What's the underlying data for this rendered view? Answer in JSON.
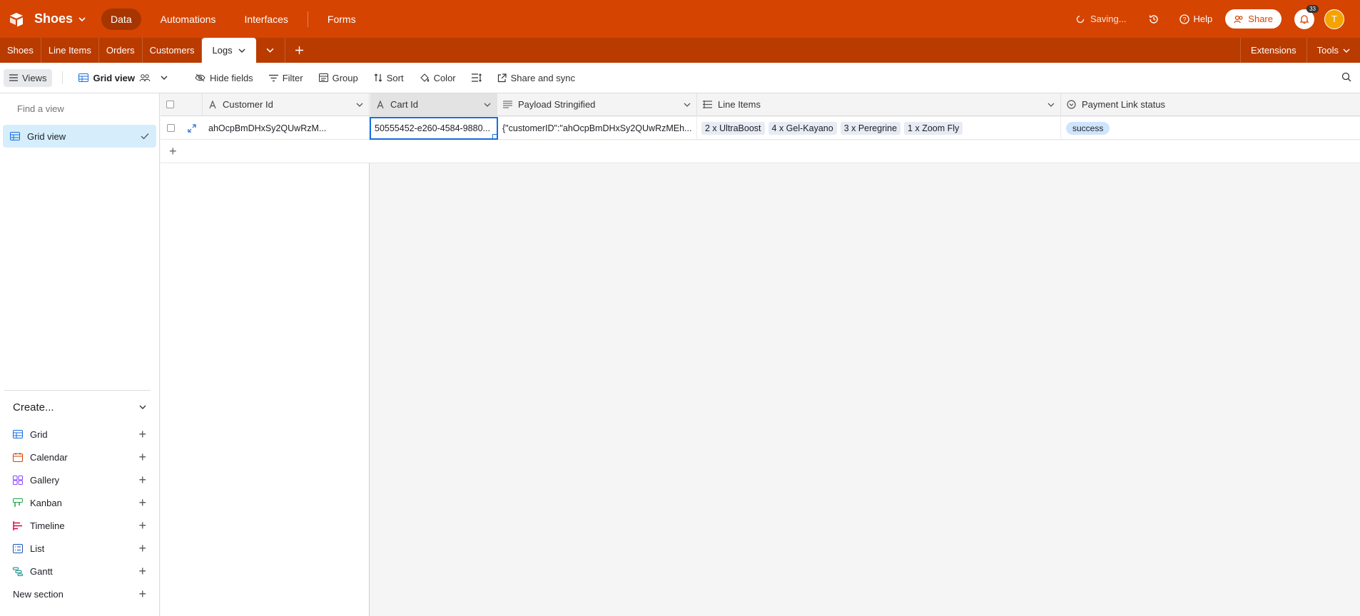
{
  "app": {
    "base_name": "Shoes",
    "nav": [
      "Data",
      "Automations",
      "Interfaces",
      "Forms"
    ],
    "saving_text": "Saving...",
    "help_label": "Help",
    "share_label": "Share",
    "notification_count": "33",
    "avatar_initial": "T",
    "brand_color": "#d54401"
  },
  "tables": {
    "tabs": [
      "Shoes",
      "Line Items",
      "Orders",
      "Customers",
      "Logs"
    ],
    "active": "Logs",
    "right": [
      "Extensions",
      "Tools"
    ]
  },
  "toolbar": {
    "views_label": "Views",
    "view_name": "Grid view",
    "hide_fields": "Hide fields",
    "filter": "Filter",
    "group": "Group",
    "sort": "Sort",
    "color": "Color",
    "share_sync": "Share and sync"
  },
  "sidebar": {
    "find_placeholder": "Find a view",
    "active_view": "Grid view",
    "create_label": "Create...",
    "create_items": [
      "Grid",
      "Calendar",
      "Gallery",
      "Kanban",
      "Timeline",
      "List",
      "Gantt"
    ],
    "new_section": "New section"
  },
  "grid": {
    "columns": [
      "Customer Id",
      "Cart Id",
      "Payload Stringified",
      "Line Items",
      "Payment Link status"
    ],
    "row": {
      "customer_id": "ahOcpBmDHxSy2QUwRzM...",
      "cart_id": "50555452-e260-4584-9880...",
      "payload": "{\"customerID\":\"ahOcpBmDHxSy2QUwRzMEh...",
      "line_items": [
        "2 x UltraBoost",
        "4 x Gel-Kayano",
        "3 x Peregrine",
        "1 x Zoom Fly"
      ],
      "payment_status": "success"
    }
  }
}
